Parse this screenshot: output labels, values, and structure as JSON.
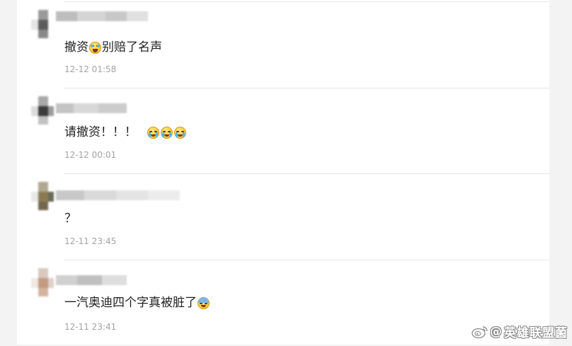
{
  "comments": [
    {
      "text_before": "撤资",
      "emoji_mid": "laughing-crying-emoji",
      "text_after": "别赔了名声",
      "time": "12-12 01:58"
    },
    {
      "text_before": "请撤资！！！",
      "emoji_after": [
        "crying-emoji",
        "crying-emoji",
        "crying-emoji"
      ],
      "text_after": "",
      "time": "12-12 00:01"
    },
    {
      "text_before": "？",
      "text_after": "",
      "time": "12-11 23:45"
    },
    {
      "text_before": "一汽奥迪四个字真被脏了",
      "emoji_after": [
        "frozen-emoji"
      ],
      "text_after": "",
      "time": "12-11 23:41"
    }
  ],
  "watermark": {
    "at_sign": "@",
    "text": "英雄联盟菌",
    "icon": "weibo-icon"
  },
  "colors": {
    "background": "#f3f3f3",
    "card": "#ffffff",
    "text": "#222222",
    "timestamp": "#a3a3a3",
    "divider": "#e6e6e6"
  }
}
